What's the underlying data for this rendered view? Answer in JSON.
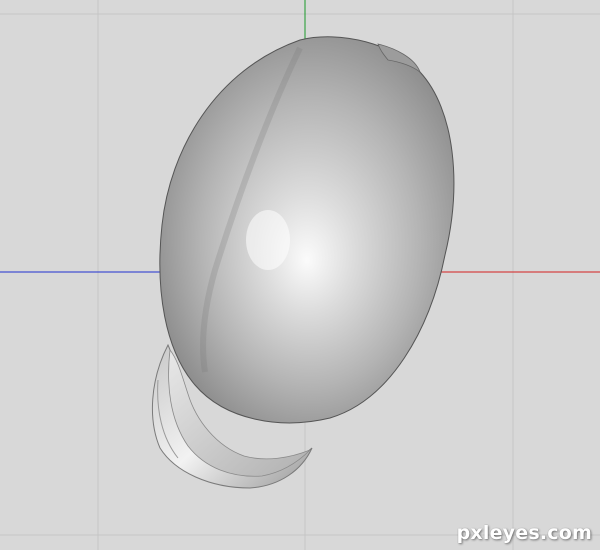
{
  "viewport": {
    "background_color": "#d8d8d8",
    "grid_color": "#c4c4c4",
    "axis_colors": {
      "x_axis": "#d42020",
      "y_axis": "#1a9a2a",
      "z_axis": "#2030d0"
    },
    "object_color": "#b8b8b8"
  },
  "watermark": {
    "text": "pxleyes.com"
  }
}
